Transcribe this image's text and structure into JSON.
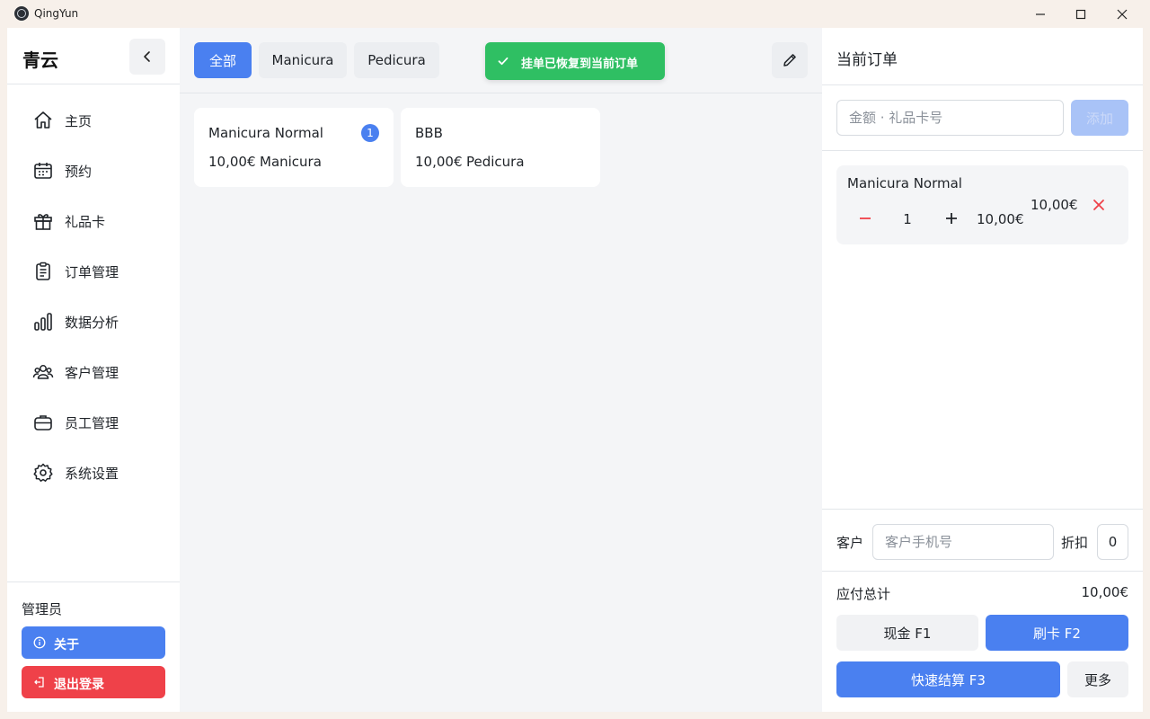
{
  "window": {
    "app_name": "QingYun"
  },
  "sidebar": {
    "brand": "青云",
    "items": [
      {
        "label": "主页",
        "icon": "home-icon"
      },
      {
        "label": "预约",
        "icon": "calendar-icon"
      },
      {
        "label": "礼品卡",
        "icon": "gift-icon"
      },
      {
        "label": "订单管理",
        "icon": "clipboard-icon"
      },
      {
        "label": "数据分析",
        "icon": "bar-chart-icon"
      },
      {
        "label": "客户管理",
        "icon": "users-icon"
      },
      {
        "label": "员工管理",
        "icon": "briefcase-icon"
      },
      {
        "label": "系统设置",
        "icon": "gear-icon"
      }
    ],
    "user_role": "管理员",
    "about_label": "关于",
    "logout_label": "退出登录"
  },
  "main": {
    "tabs": [
      {
        "label": "全部",
        "active": true
      },
      {
        "label": "Manicura",
        "active": false
      },
      {
        "label": "Pedicura",
        "active": false
      }
    ],
    "products": [
      {
        "name": "Manicura Normal",
        "price": "10,00€",
        "category": "Manicura",
        "count": "1"
      },
      {
        "name": "BBB",
        "price": "10,00€",
        "category": "Pedicura",
        "count": ""
      }
    ]
  },
  "toast": {
    "text": "挂单已恢复到当前订单",
    "color": "#2fbf63"
  },
  "order": {
    "title": "当前订单",
    "giftcard_placeholder": "金额 · 礼品卡号",
    "add_label": "添加",
    "items": [
      {
        "name": "Manicura Normal",
        "qty": "1",
        "unit_price": "10,00€",
        "total": "10,00€"
      }
    ],
    "customer_label": "客户",
    "customer_placeholder": "客户手机号",
    "discount_label": "折扣",
    "discount_value": "0",
    "total_label": "应付总计",
    "total_value": "10,00€",
    "cash_label": "现金  F1",
    "card_label": "刷卡  F2",
    "quick_label": "快速结算  F3",
    "more_label": "更多"
  },
  "colors": {
    "accent": "#4a80f0",
    "danger": "#ef4149",
    "success": "#2fbf63"
  }
}
